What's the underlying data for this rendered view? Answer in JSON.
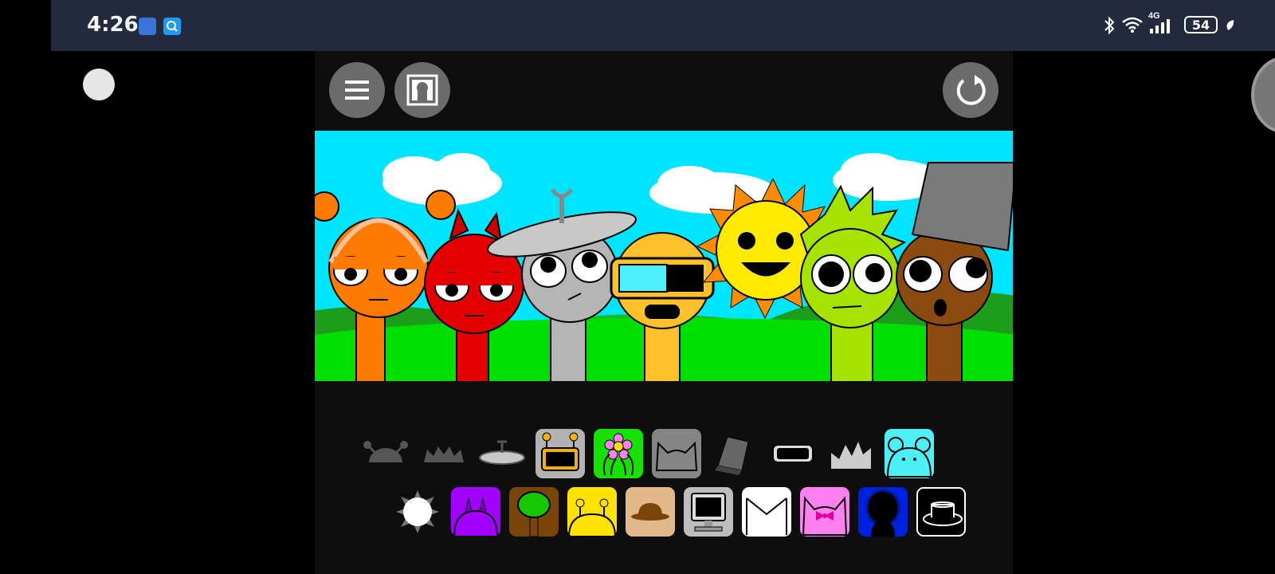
{
  "status_bar": {
    "time": "4:26",
    "network": "4G",
    "battery": "54",
    "icons": [
      "notification-app-icon",
      "search-app-icon",
      "bluetooth-icon",
      "wifi-icon",
      "signal-icon",
      "battery-icon",
      "leaf-icon"
    ]
  },
  "toolbar": {
    "left_buttons": [
      "menu-icon",
      "frame-icon"
    ],
    "right_buttons": [
      "reset-icon"
    ]
  },
  "ad_controls": {
    "icons": [
      "mute-icon",
      "headphones-icon",
      "close-icon"
    ],
    "mute": "🔇",
    "headphones": "🎧",
    "close": "✕"
  },
  "scene": {
    "characters": [
      {
        "name": "orange-headphones",
        "color": "#ff7a00"
      },
      {
        "name": "red-horns",
        "color": "#e30000"
      },
      {
        "name": "gray-antenna",
        "color": "#b5b5b5"
      },
      {
        "name": "yellow-visor",
        "color": "#ffc02a"
      },
      {
        "name": "sun",
        "color": "#ffea00"
      },
      {
        "name": "green-spiky",
        "color": "#a4e400"
      },
      {
        "name": "brown-bucket",
        "color": "#8a4a10"
      }
    ]
  },
  "palette": {
    "row1": [
      {
        "name": "antenna-balls",
        "bg": null
      },
      {
        "name": "spiky-hair",
        "bg": null
      },
      {
        "name": "satellite-hat",
        "bg": null
      },
      {
        "name": "robot-head",
        "bg": "#b3b3b3"
      },
      {
        "name": "flower",
        "bg": "#15e200"
      },
      {
        "name": "cat-ears",
        "bg": "#858585"
      },
      {
        "name": "bucket",
        "bg": null
      },
      {
        "name": "visor",
        "bg": null
      },
      {
        "name": "crown",
        "bg": null
      },
      {
        "name": "bear-ears",
        "bg": "#4cf0f5"
      }
    ],
    "row2": [
      {
        "name": "sun-rays",
        "bg": null
      },
      {
        "name": "purple-horns",
        "bg": "#a200ff"
      },
      {
        "name": "tree",
        "bg": "#7a4508"
      },
      {
        "name": "yellow-antennae",
        "bg": "#ffe300"
      },
      {
        "name": "brown-hat",
        "bg": "#e2b98a"
      },
      {
        "name": "computer",
        "bg": "#bdbdbd"
      },
      {
        "name": "white-envelope",
        "bg": "#ffffff"
      },
      {
        "name": "pink-bow",
        "bg": "#ff80f0"
      },
      {
        "name": "blue-hood",
        "bg": "#0020e0"
      },
      {
        "name": "top-hat",
        "bg": "#000000"
      }
    ]
  }
}
